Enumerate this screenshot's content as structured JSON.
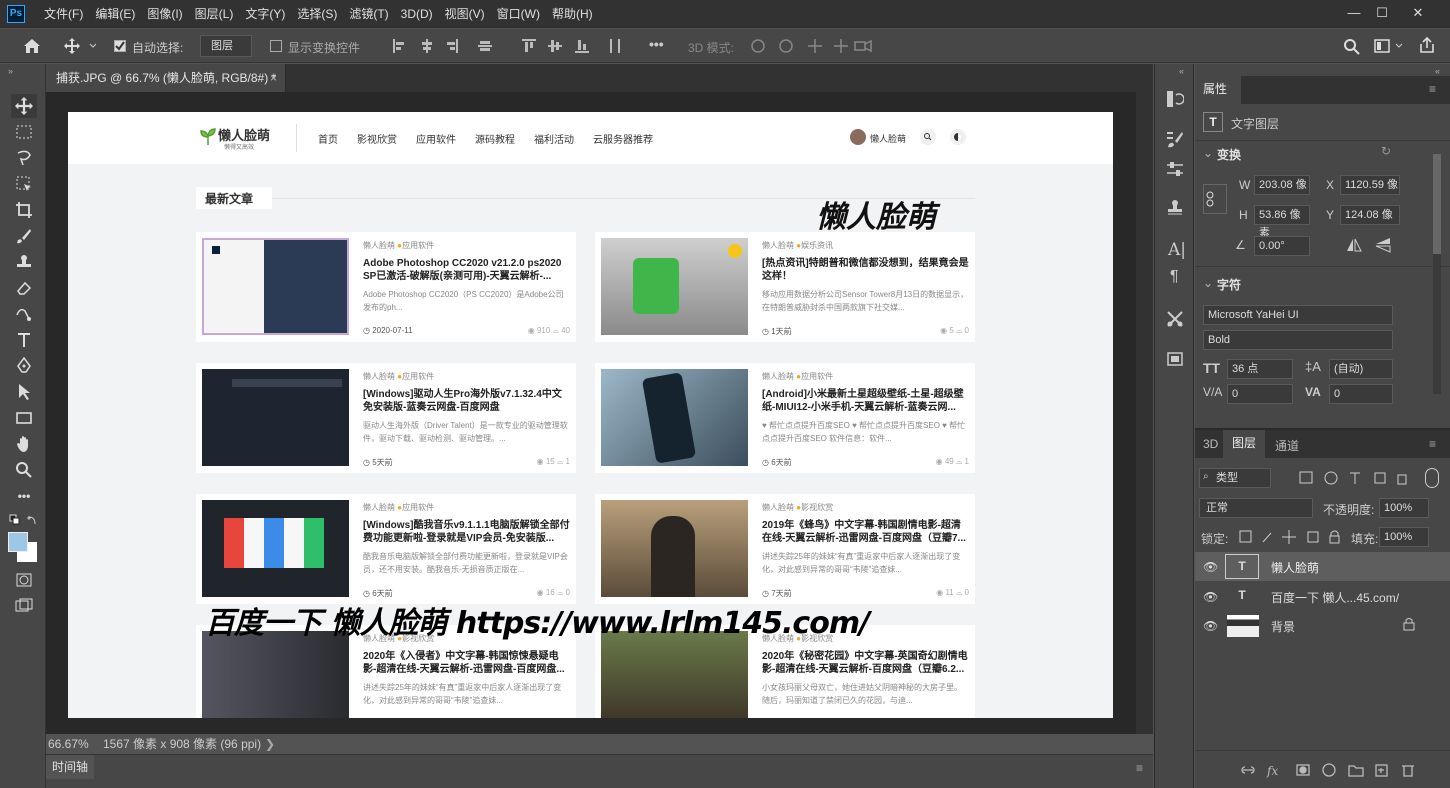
{
  "app": {
    "logo": "Ps",
    "menus": [
      "文件(F)",
      "编辑(E)",
      "图像(I)",
      "图层(L)",
      "文字(Y)",
      "选择(S)",
      "滤镜(T)",
      "3D(D)",
      "视图(V)",
      "窗口(W)",
      "帮助(H)"
    ]
  },
  "options": {
    "auto_select_label": "自动选择:",
    "auto_select_target": "图层",
    "show_transform_label": "显示变换控件",
    "mode_3d_label": "3D 模式:",
    "more": "•••"
  },
  "document": {
    "tab_title": "捕获.JPG @ 66.7% (懒人脸萌, RGB/8#) *",
    "zoom": "66.67%",
    "doc_info": "1567 像素 x 908 像素 (96 ppi)"
  },
  "timeline": {
    "label": "时间轴"
  },
  "canvas": {
    "logo_main": "懒人脸萌",
    "logo_sub": "懒得又高效",
    "nav": [
      "首页",
      "影视欣赏",
      "应用软件",
      "源码教程",
      "福利活动",
      "云服务器推荐"
    ],
    "user": "懒人脸萌",
    "section_title": "最新文章",
    "overlay_top": "懒人脸萌",
    "overlay_bottom": "百度一下 懒人脸萌 https://www.lrlm145.com/",
    "cards": [
      {
        "author": "懒人脸萌",
        "cat": "应用软件",
        "title": "Adobe Photoshop CC2020 v21.2.0 ps2020 SP已激活-破解版(亲测可用)-天翼云解析-...",
        "desc": "Adobe Photoshop CC2020（PS CC2020）是Adobe公司发布的ph...",
        "date": "2020-07-11",
        "views": "910",
        "comments": "40"
      },
      {
        "author": "懒人脸萌",
        "cat": "娱乐资讯",
        "title": "[热点资讯]特朗普和微信都没想到，结果竟会是这样！",
        "desc": "移动应用数据分析公司Sensor Tower8月13日的数据显示，在特朗普威胁封杀中国两款旗下社交媒...",
        "date": "1天前",
        "views": "5",
        "comments": "0"
      },
      {
        "author": "懒人脸萌",
        "cat": "应用软件",
        "title": "[Windows]驱动人生Pro海外版v7.1.32.4中文免安装版-蓝奏云网盘-百度网盘",
        "desc": "驱动人生海外版（Driver Talent）是一款专业的驱动管理软件，驱动下载、驱动检测、驱动管理。...",
        "date": "5天前",
        "views": "15",
        "comments": "1"
      },
      {
        "author": "懒人脸萌",
        "cat": "应用软件",
        "title": "[Android]小米最新土星超级壁纸-土星-超级壁纸-MIUI12-小米手机-天翼云解析-蓝奏云网...",
        "desc": "♥ 帮忙点点提升百度SEO ♥ 帮忙点点提升百度SEO ♥ 帮忙点点提升百度SEO 软件信息：软件...",
        "date": "6天前",
        "views": "49",
        "comments": "1"
      },
      {
        "author": "懒人脸萌",
        "cat": "应用软件",
        "title": "[Windows]酷我音乐v9.1.1.1电脑版解锁全部付费功能更新啦-登录就是VIP会员-免安装版...",
        "desc": "酷我音乐电脑版解锁全部付费功能更新啦，登录就是VIP会员，还不用安装。酷我音乐-无损音质正版在...",
        "date": "6天前",
        "views": "16",
        "comments": "0"
      },
      {
        "author": "懒人脸萌",
        "cat": "影视欣赏",
        "title": "2019年《蜂鸟》中文字幕-韩国剧情电影-超清在线-天翼云解析-迅雷网盘-百度网盘（豆瓣7...",
        "desc": "讲述失踪25年的妹妹“有真”重返家中后家人逐渐出现了变化，对此感到异常的哥哥“韦陵”追查妹...",
        "date": "7天前",
        "views": "11",
        "comments": "0"
      },
      {
        "author": "懒人脸萌",
        "cat": "影视欣赏",
        "title": "2020年《入侵者》中文字幕-韩国惊悚悬疑电影-超清在线-天翼云解析-迅雷网盘-百度网盘...",
        "desc": "讲述失踪25年的妹妹“有真”重返家中后家人逐渐出现了变化，对此感到异常的哥哥“韦陵”追查妹...",
        "date": "",
        "views": "",
        "comments": ""
      },
      {
        "author": "懒人脸萌",
        "cat": "影视欣赏",
        "title": "2020年《秘密花园》中文字幕-英国奇幻剧情电影-超清在线-天翼云解析-百度网盘（豆瓣6.2...",
        "desc": "小女孩玛丽父母双亡，她住进姑父阴暗神秘的大房子里。随后，玛丽知道了禁闭已久的花园，与迪...",
        "date": "",
        "views": "",
        "comments": ""
      }
    ]
  },
  "properties": {
    "tab": "属性",
    "layer_type": "文字图层",
    "transform_title": "变换",
    "W_label": "W",
    "W": "203.08 像",
    "X_label": "X",
    "X": "1120.59 像",
    "H_label": "H",
    "H": "53.86 像素",
    "Y_label": "Y",
    "Y": "124.08 像",
    "angle": "0.00°",
    "char_title": "字符",
    "font_family": "Microsoft YaHei UI",
    "font_style": "Bold",
    "font_size": "36 点",
    "leading": "(自动)",
    "kerning": "0",
    "tracking": "0"
  },
  "layers": {
    "tabs": [
      "3D",
      "图层",
      "通道"
    ],
    "filter": "类型",
    "blend_mode": "正常",
    "opacity_label": "不透明度:",
    "opacity": "100%",
    "lock_label": "锁定:",
    "fill_label": "填充:",
    "fill": "100%",
    "items": [
      {
        "name": "懒人脸萌",
        "kind": "T"
      },
      {
        "name": "百度一下 懒人...45.com/",
        "kind": "T"
      },
      {
        "name": "背景",
        "kind": "img"
      }
    ]
  }
}
